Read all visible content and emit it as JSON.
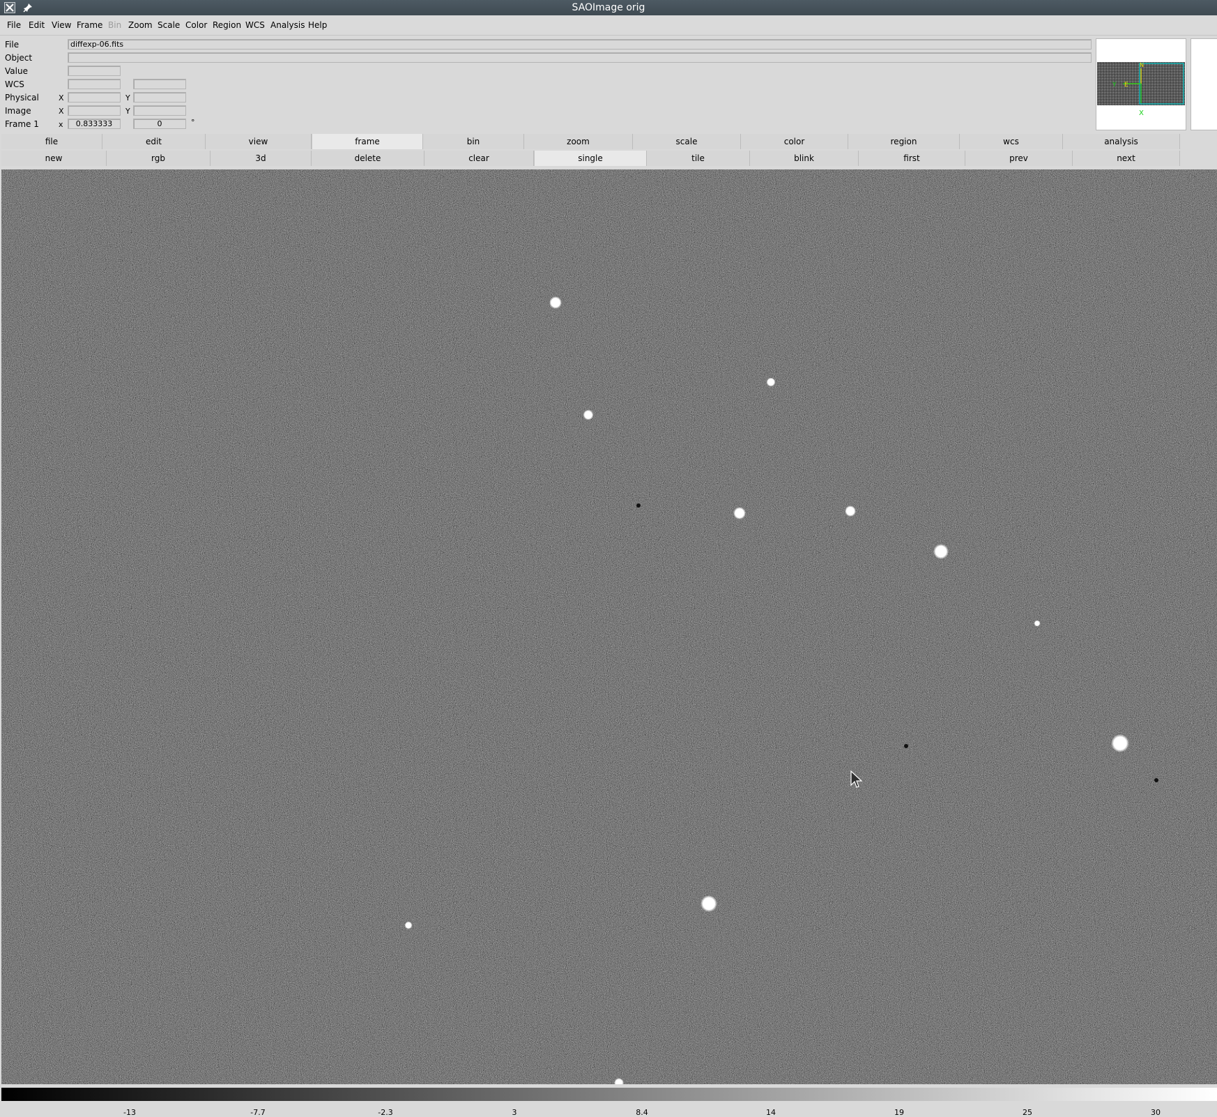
{
  "window": {
    "title": "SAOImage orig",
    "icons": [
      "x-window-icon",
      "pin-icon"
    ]
  },
  "menubar": [
    "File",
    "Edit",
    "View",
    "Frame",
    "Bin",
    "Zoom",
    "Scale",
    "Color",
    "Region",
    "WCS",
    "Analysis",
    "Help"
  ],
  "menubar_disabled": [
    "Bin"
  ],
  "info": {
    "file_label": "File",
    "file_value": "diffexp-06.fits",
    "object_label": "Object",
    "object_value": "",
    "value_label": "Value",
    "value_value": "",
    "wcs_label": "WCS",
    "wcs_values": [
      "",
      ""
    ],
    "physical_label": "Physical",
    "physical_x_label": "X",
    "physical_y_label": "Y",
    "physical_x": "",
    "physical_y": "",
    "image_label": "Image",
    "image_x_label": "X",
    "image_y_label": "Y",
    "image_x": "",
    "image_y": "",
    "frame_label": "Frame 1",
    "frame_x_label": "x",
    "frame_zoom": "0.833333",
    "frame_angle": "0",
    "frame_angle_unit": "°"
  },
  "panner": {
    "compass_x": "X",
    "compass_y": "Y",
    "compass_e": "E",
    "compass_n": "N"
  },
  "buttonbar_top": [
    "file",
    "edit",
    "view",
    "frame",
    "bin",
    "zoom",
    "scale",
    "color",
    "region",
    "wcs",
    "analysis"
  ],
  "buttonbar_top_active": "frame",
  "buttonbar_bottom": [
    "new",
    "rgb",
    "3d",
    "delete",
    "clear",
    "single",
    "tile",
    "blink",
    "first",
    "prev",
    "next"
  ],
  "buttonbar_bottom_active": "single",
  "colorbar": {
    "ticks": [
      "-13",
      "-7.7",
      "-2.3",
      "3",
      "8.4",
      "14",
      "19",
      "25",
      "30"
    ],
    "colors": {
      "low": "#000000",
      "high": "#ffffff"
    }
  },
  "image": {
    "background_color": "#585858",
    "source_color": "#ffffff"
  }
}
